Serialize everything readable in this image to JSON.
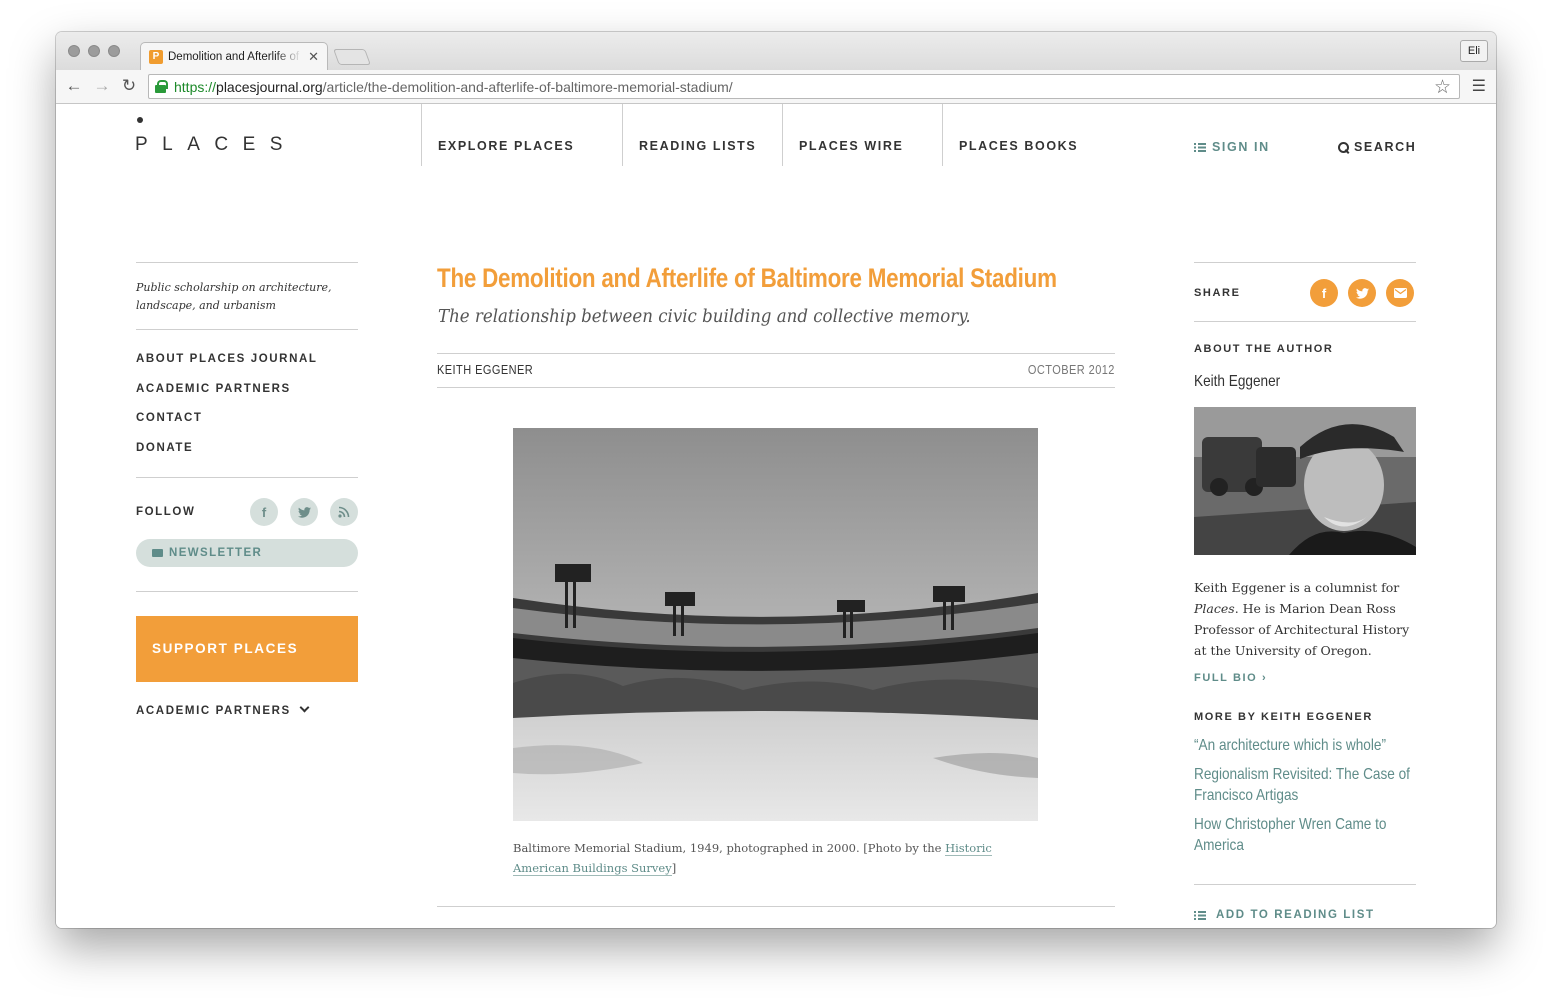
{
  "browser": {
    "tab_title": "Demolition and Afterlife of Baltimore Memorial Stadium",
    "tab_favicon": "P",
    "profile": "Eli",
    "url": {
      "scheme": "https://",
      "host": "placesjournal.org",
      "path": "/article/the-demolition-and-afterlife-of-baltimore-memorial-stadium/"
    }
  },
  "site": {
    "logo": "PLACES",
    "nav": [
      "EXPLORE PLACES",
      "READING LISTS",
      "PLACES WIRE",
      "PLACES BOOKS"
    ],
    "sign_in": "SIGN IN",
    "search": "SEARCH",
    "accent_color": "#f29e3a",
    "link_color": "#5f8c89"
  },
  "sidebar": {
    "tagline": "Public scholarship on architecture, landscape, and urbanism",
    "links": [
      "ABOUT PLACES JOURNAL",
      "ACADEMIC PARTNERS",
      "CONTACT",
      "DONATE"
    ],
    "follow_label": "FOLLOW",
    "follow_icons": [
      "facebook-icon",
      "twitter-icon",
      "rss-icon"
    ],
    "newsletter": "NEWSLETTER",
    "support": "SUPPORT PLACES",
    "partners_dropdown": "ACADEMIC PARTNERS"
  },
  "article": {
    "title": "The Demolition and Afterlife of Baltimore Memorial Stadium",
    "subtitle": "The relationship between civic building and collective memory.",
    "author": "KEITH EGGENER",
    "date": "OCTOBER 2012",
    "caption_text": "Baltimore Memorial Stadium, 1949, photographed in 2000. [Photo by the ",
    "caption_link": "Historic American Buildings Survey",
    "caption_end": "]"
  },
  "right": {
    "share_label": "SHARE",
    "share_icons": [
      "facebook-icon",
      "twitter-icon",
      "email-icon"
    ],
    "about_label": "ABOUT THE AUTHOR",
    "author_name": "Keith Eggener",
    "bio_1": "Keith Eggener is a columnist for ",
    "bio_italic": "Places",
    "bio_2": ". He is Marion Dean Ross Professor of Architectural History at the University of Oregon.",
    "full_bio": "FULL BIO",
    "more_label": "MORE BY KEITH EGGENER",
    "more_links": [
      "“An architecture which is whole”",
      "Regionalism Revisited: The Case of Francisco Artigas",
      "How Christopher Wren Came to America"
    ],
    "add_reading": "ADD TO READING LIST"
  }
}
